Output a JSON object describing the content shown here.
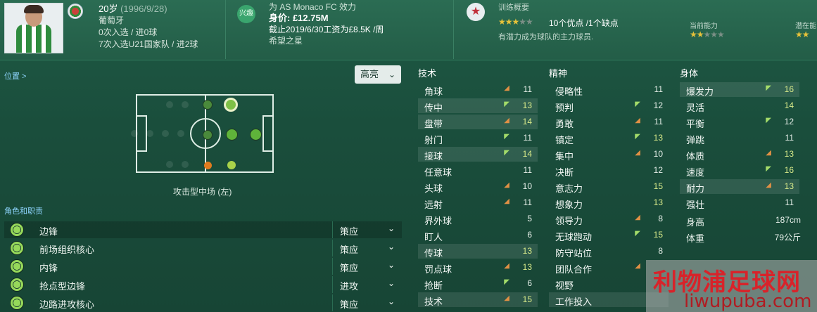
{
  "header": {
    "age": "20岁",
    "birth": "(1996/9/28)",
    "nationality": "葡萄牙",
    "caps": "0次入选 / 进0球",
    "u21": "7次入选U21国家队 / 进2球",
    "badge_text": "兴趣",
    "club_line": "为 AS Monaco FC 效力",
    "value": "身价: £12.75M",
    "wage": "截止2019/6/30工资为£8.5K /周",
    "tag": "希望之星",
    "training_title": "训练概要",
    "training_stars": "★★★",
    "training_stars_dim": "★★",
    "training_count": "10个优点 /1个缺点",
    "training_desc": "有潜力成为球队的主力球员.",
    "current_ability_label": "当前能力",
    "current_stars": "★★",
    "current_stars_dim": "★★★",
    "potential_label": "潜在能",
    "potential_stars": "★★"
  },
  "position": {
    "link": "位置 >",
    "dropdown": "高亮",
    "name": "攻击型中场 (左)"
  },
  "roles": {
    "title": "角色和职责",
    "items": [
      {
        "name": "边锋",
        "duty": "策应"
      },
      {
        "name": "前场组织核心",
        "duty": "策应"
      },
      {
        "name": "内锋",
        "duty": "策应"
      },
      {
        "name": "抢点型边锋",
        "duty": "进攻"
      },
      {
        "name": "边路进攻核心",
        "duty": "策应"
      }
    ]
  },
  "attributes": {
    "technical_title": "技术",
    "mental_title": "精神",
    "physical_title": "身体",
    "technical": [
      {
        "label": "角球",
        "value": "11",
        "arrow": "down"
      },
      {
        "label": "传中",
        "value": "13",
        "arrow": "up"
      },
      {
        "label": "盘带",
        "value": "14",
        "arrow": "down"
      },
      {
        "label": "射门",
        "value": "11",
        "arrow": "up"
      },
      {
        "label": "接球",
        "value": "14",
        "arrow": "up"
      },
      {
        "label": "任意球",
        "value": "11",
        "arrow": ""
      },
      {
        "label": "头球",
        "value": "10",
        "arrow": "down"
      },
      {
        "label": "远射",
        "value": "11",
        "arrow": "down"
      },
      {
        "label": "界外球",
        "value": "5",
        "arrow": ""
      },
      {
        "label": "盯人",
        "value": "6",
        "arrow": ""
      },
      {
        "label": "传球",
        "value": "13",
        "arrow": ""
      },
      {
        "label": "罚点球",
        "value": "13",
        "arrow": "down"
      },
      {
        "label": "抢断",
        "value": "6",
        "arrow": "up"
      },
      {
        "label": "技术",
        "value": "15",
        "arrow": "down"
      }
    ],
    "mental": [
      {
        "label": "侵略性",
        "value": "11",
        "arrow": ""
      },
      {
        "label": "预判",
        "value": "12",
        "arrow": "up"
      },
      {
        "label": "勇敢",
        "value": "11",
        "arrow": "down"
      },
      {
        "label": "镇定",
        "value": "13",
        "arrow": "up"
      },
      {
        "label": "集中",
        "value": "10",
        "arrow": "down"
      },
      {
        "label": "决断",
        "value": "12",
        "arrow": ""
      },
      {
        "label": "意志力",
        "value": "15",
        "arrow": ""
      },
      {
        "label": "想象力",
        "value": "13",
        "arrow": ""
      },
      {
        "label": "领导力",
        "value": "8",
        "arrow": "down"
      },
      {
        "label": "无球跑动",
        "value": "15",
        "arrow": "up"
      },
      {
        "label": "防守站位",
        "value": "8",
        "arrow": ""
      },
      {
        "label": "团队合作",
        "value": "",
        "arrow": "down"
      },
      {
        "label": "视野",
        "value": "",
        "arrow": ""
      },
      {
        "label": "工作投入",
        "value": "",
        "arrow": ""
      }
    ],
    "physical": [
      {
        "label": "爆发力",
        "value": "16",
        "arrow": "up"
      },
      {
        "label": "灵活",
        "value": "14",
        "arrow": ""
      },
      {
        "label": "平衡",
        "value": "12",
        "arrow": "up"
      },
      {
        "label": "弹跳",
        "value": "11",
        "arrow": ""
      },
      {
        "label": "体质",
        "value": "13",
        "arrow": "down"
      },
      {
        "label": "速度",
        "value": "16",
        "arrow": "up"
      },
      {
        "label": "耐力",
        "value": "13",
        "arrow": "down"
      },
      {
        "label": "强壮",
        "value": "11",
        "arrow": ""
      }
    ],
    "height_label": "身高",
    "height_value": "187cm",
    "weight_label": "体重",
    "weight_value": "79公斤"
  },
  "watermark": {
    "big": "利物浦足球网",
    "small": "liwupuba.com"
  }
}
